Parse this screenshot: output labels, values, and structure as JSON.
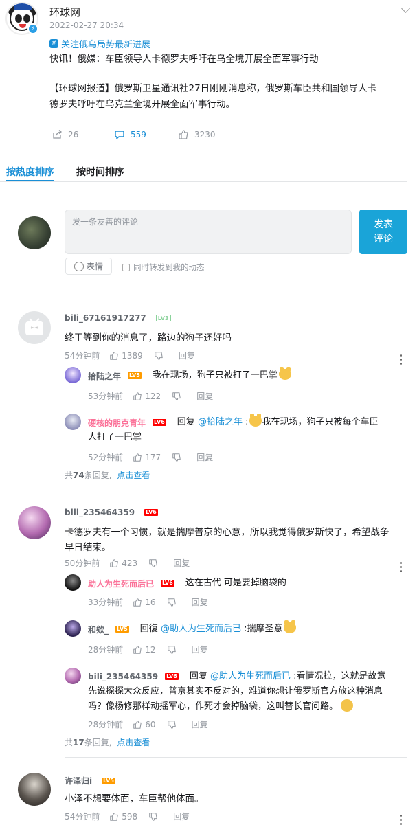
{
  "post": {
    "author": "环球网",
    "time": "2022-02-27 20:34",
    "topic": "关注俄乌局势最新进展",
    "headline": "快讯！俄媒：车臣领导人卡德罗夫呼吁在乌全境开展全面军事行动",
    "body_line1": "【环球网报道】俄罗斯卫星通讯社27日刚刚消息称，俄罗斯车臣共和国领导人卡",
    "body_line2": "德罗夫呼吁在乌克兰全境开展全面军事行动。",
    "shares": "26",
    "comments": "559",
    "likes": "3230"
  },
  "sort": {
    "hot": "按热度排序",
    "time": "按时间排序"
  },
  "composer": {
    "placeholder": "发一条友善的评论",
    "submit_line1": "发表",
    "submit_line2": "评论",
    "emoji": "表情",
    "repost": "同时转发到我的动态"
  },
  "labels": {
    "reply": "回复",
    "reply_alt": "回復",
    "view": "点击查看"
  },
  "comments": [
    {
      "user": "bili_67161917277",
      "level": "LV3",
      "text": "终于等到你的消息了，路边的狗子还好吗",
      "time": "54分钟前",
      "likes": "1389",
      "replies": [
        {
          "user": "拾陆之年",
          "level": "LV5",
          "text": "我在现场，狗子只被打了一巴掌",
          "time": "53分钟前",
          "likes": "122"
        },
        {
          "user": "硬核的朋克青年",
          "level": "LV6",
          "at": "@拾陆之年",
          "text_line1": "我在现场，狗子只被每个车臣",
          "text_line2": "人打了一巴掌",
          "time": "52分钟前",
          "likes": "177"
        }
      ],
      "summary_pre": "共",
      "summary_count": "74",
      "summary_post": "条回复,"
    },
    {
      "user": "bili_235464359",
      "level": "LV6",
      "text_line1": "卡德罗夫有一个习惯，就是揣摩普京的心意，所以我觉得俄罗斯快了，希望战争",
      "text_line2": "早日结束。",
      "time": "50分钟前",
      "likes": "423",
      "replies": [
        {
          "user": "助人为生死而后已",
          "level": "LV6",
          "text": "这在古代 可是要掉脑袋的",
          "time": "33分钟前",
          "likes": "16"
        },
        {
          "user": "和欸_",
          "level": "LV5",
          "at": "@助人为生死而后已",
          "text": ":揣摩圣意",
          "time": "28分钟前",
          "likes": "12"
        },
        {
          "user": "bili_235464359",
          "level": "LV6",
          "at": "@助人为生死而后已",
          "text_line1": ":看情况拉，这就是故意",
          "text_line2": "先说探探大众反应，普京其实不反对的，难道你想让俄罗斯官方放这种消息",
          "text_line3": "吗？像杨修那样动摇军心，作死才会掉脑袋，这叫替长官问路。",
          "time": "28分钟前",
          "likes": "60"
        }
      ],
      "summary_pre": "共",
      "summary_count": "17",
      "summary_post": "条回复,"
    },
    {
      "user": "许泽归i",
      "level": "LV5",
      "text": "小泽不想要体面，车臣帮他体面。",
      "time": "54分钟前",
      "likes": "598"
    }
  ]
}
